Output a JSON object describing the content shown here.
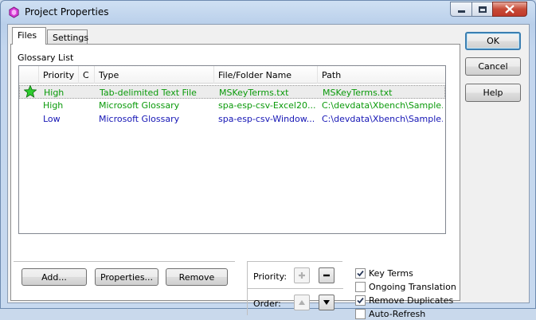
{
  "window": {
    "title": "Project Properties"
  },
  "tabs": [
    {
      "label": "Files"
    },
    {
      "label": "Settings"
    }
  ],
  "glossary": {
    "label": "Glossary List",
    "columns": [
      "Priority",
      "C",
      "Type",
      "File/Folder Name",
      "Path"
    ],
    "rows": [
      {
        "priority": "High",
        "c": "",
        "type": "Tab-delimited Text File",
        "name": "MSKeyTerms.txt",
        "path": "MSKeyTerms.txt",
        "color": "#0a9a0a",
        "starred": true,
        "selected": true
      },
      {
        "priority": "High",
        "c": "",
        "type": "Microsoft Glossary",
        "name": "spa-esp-csv-Excel20...",
        "path": "C:\\devdata\\Xbench\\Sample...",
        "color": "#0a9a0a",
        "starred": false,
        "selected": false
      },
      {
        "priority": "Low",
        "c": "",
        "type": "Microsoft Glossary",
        "name": "spa-esp-csv-Window...",
        "path": "C:\\devdata\\Xbench\\Sample...",
        "color": "#1515b5",
        "starred": false,
        "selected": false
      }
    ]
  },
  "buttons": {
    "add": "Add...",
    "properties": "Properties...",
    "remove": "Remove",
    "ok": "OK",
    "cancel": "Cancel",
    "help": "Help"
  },
  "priority": {
    "label": "Priority:"
  },
  "order": {
    "label": "Order:"
  },
  "options": [
    {
      "label": "Key Terms",
      "checked": true
    },
    {
      "label": "Ongoing Translation",
      "checked": false
    },
    {
      "label": "Remove Duplicates",
      "checked": true
    },
    {
      "label": "Auto-Refresh",
      "checked": false
    }
  ],
  "icons": {
    "app": "hexagon-app-icon",
    "star": "green-star-icon",
    "plus": "plus-icon",
    "minus": "minus-icon",
    "up": "triangle-up-icon",
    "down": "triangle-down-icon",
    "check": "checkmark-icon"
  }
}
